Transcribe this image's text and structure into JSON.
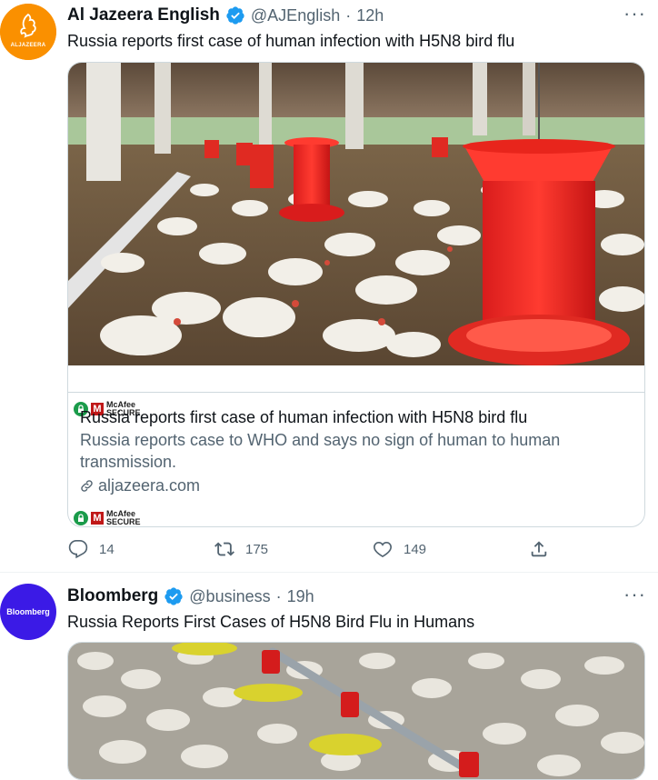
{
  "tweets": [
    {
      "author": {
        "name": "Al Jazeera English",
        "handle": "@AJEnglish",
        "separator": "·",
        "time": "12h",
        "avatar_color": "#fa9000",
        "avatar_text": "ALJAZEERA"
      },
      "text": "Russia reports first case of human infection with H5N8 bird flu",
      "card": {
        "image_icon": "poultry-farm-red-feeders-photo",
        "title": "Russia reports first case of human infection with H5N8 bird flu",
        "description": "Russia reports case to WHO and says no sign of human to human transmission.",
        "domain": "aljazeera.com",
        "badge_text_1": "McAfee",
        "badge_text_2": "SECURE"
      },
      "actions": {
        "replies": "14",
        "retweets": "175",
        "likes": "149"
      }
    },
    {
      "author": {
        "name": "Bloomberg",
        "handle": "@business",
        "separator": "·",
        "time": "19h",
        "avatar_color": "#3b1ae6",
        "avatar_text": "Bloomberg"
      },
      "text": "Russia Reports First Cases of H5N8 Bird Flu in Humans",
      "card": {
        "image_icon": "chicken-barn-yellow-feeders-photo"
      }
    }
  ],
  "colors": {
    "verified": "#1d9bf0",
    "secondary_text": "#536471",
    "border": "#cfd9de"
  }
}
